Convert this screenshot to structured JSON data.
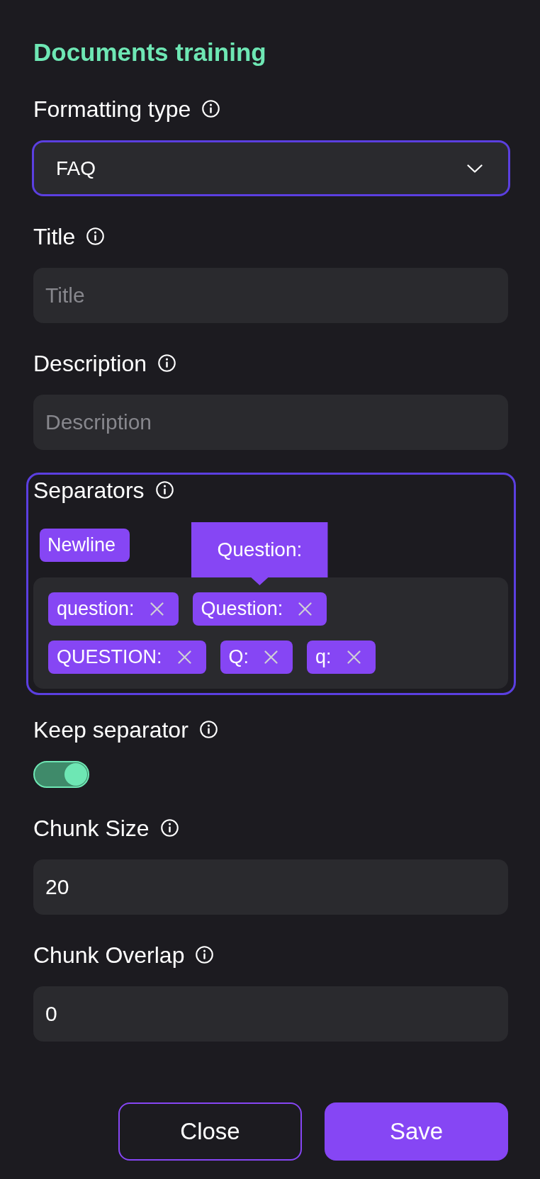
{
  "heading": "Documents training",
  "fields": [
    {
      "kind": "select",
      "label": "Formatting type",
      "value": "FAQ",
      "focused": true
    },
    {
      "kind": "text",
      "label": "Title",
      "placeholder": "Title",
      "focused": false
    },
    {
      "kind": "text",
      "label": "Description",
      "placeholder": "Description",
      "focused": false
    },
    {
      "kind": "tags",
      "label": "Separators",
      "focused": true,
      "suggestions": [
        {
          "label": "Newline"
        }
      ],
      "tags": [
        {
          "label": "question:"
        },
        {
          "label": "Question:",
          "tooltip": "Question:"
        },
        {
          "label": "QUESTION:"
        },
        {
          "label": "Q:"
        },
        {
          "label": "q:"
        }
      ]
    },
    {
      "kind": "toggle",
      "label": "Keep separator",
      "on": true
    },
    {
      "kind": "text",
      "label": "Chunk Size",
      "value": "20",
      "focused": false
    },
    {
      "kind": "text",
      "label": "Chunk Overlap",
      "value": "0",
      "focused": false
    }
  ],
  "buttons": [
    {
      "label": "Close",
      "kind": "outline"
    },
    {
      "label": "Save",
      "kind": "primary"
    }
  ]
}
